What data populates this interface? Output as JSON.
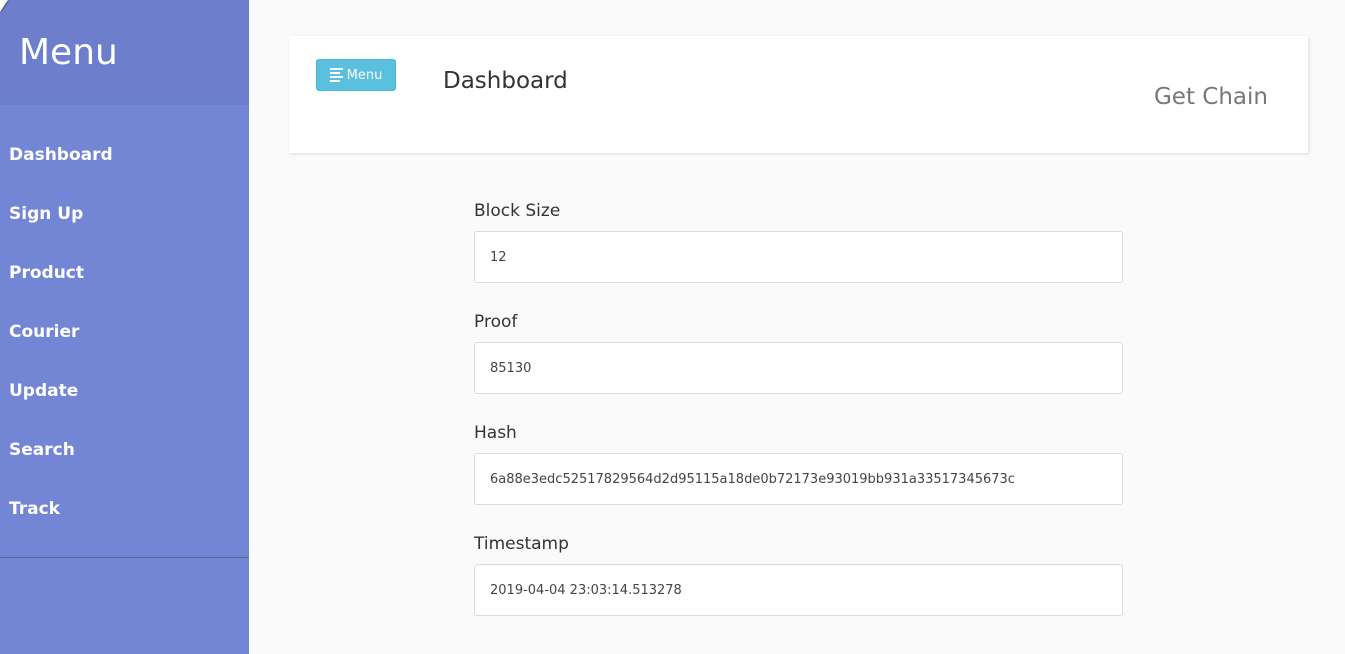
{
  "sidebar": {
    "title": "Menu",
    "items": [
      {
        "label": "Dashboard"
      },
      {
        "label": "Sign Up"
      },
      {
        "label": "Product"
      },
      {
        "label": "Courier"
      },
      {
        "label": "Update"
      },
      {
        "label": "Search"
      },
      {
        "label": "Track"
      }
    ]
  },
  "header": {
    "menu_button_label": "Menu",
    "title": "Dashboard",
    "get_chain_label": "Get Chain"
  },
  "form": {
    "fields": [
      {
        "label": "Block Size",
        "value": "12"
      },
      {
        "label": "Proof",
        "value": "85130"
      },
      {
        "label": "Hash",
        "value": "6a88e3edc52517829564d2d95115a18de0b72173e93019bb931a33517345673c"
      },
      {
        "label": "Timestamp",
        "value": "2019-04-04 23:03:14.513278"
      }
    ]
  },
  "colors": {
    "sidebar_bg": "#7386d5",
    "sidebar_header_bg": "#6d7fcc",
    "menu_button_bg": "#5bc0de"
  }
}
